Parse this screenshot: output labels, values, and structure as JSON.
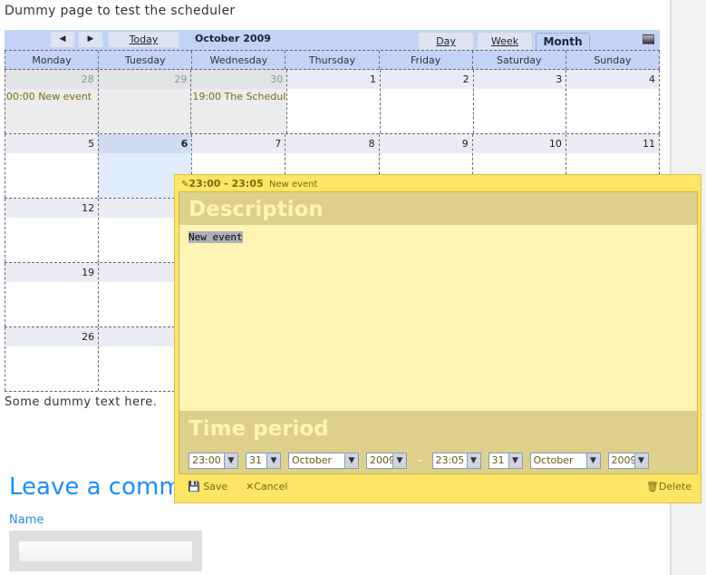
{
  "page": {
    "title": "Dummy page to test the scheduler",
    "dummy_text": "Some dummy text here.",
    "comment_heading": "Leave a comment",
    "name_label": "Name"
  },
  "calendar": {
    "prev": "◀",
    "next": "▶",
    "today": "Today",
    "month_title": "October 2009",
    "tabs": [
      "Day",
      "Week",
      "Month"
    ],
    "active_tab": "Month",
    "weekdays": [
      "Monday",
      "Tuesday",
      "Wednesday",
      "Thursday",
      "Friday",
      "Saturday",
      "Sunday"
    ],
    "weeks": [
      {
        "days": [
          "28",
          "29",
          "30",
          "1",
          "2",
          "3",
          "4"
        ]
      },
      {
        "days": [
          "5",
          "6",
          "7",
          "8",
          "9",
          "10",
          "11"
        ]
      },
      {
        "days": [
          "12",
          "",
          "",
          "",
          "",
          "",
          ""
        ]
      },
      {
        "days": [
          "19",
          "",
          "",
          "",
          "",
          "",
          ""
        ]
      },
      {
        "days": [
          "26",
          "",
          "",
          "",
          "",
          "",
          ""
        ]
      }
    ],
    "events": {
      "monday": "00:00 New event",
      "wednesday": "19:00 The Schedul"
    }
  },
  "popup": {
    "time": "23:00 - 23:05",
    "title": "New event",
    "description_label": "Description",
    "description_value": "New event",
    "time_period_label": "Time period",
    "start": {
      "time": "23:00",
      "day": "31",
      "month": "October",
      "year": "2009"
    },
    "end": {
      "time": "23:05",
      "day": "31",
      "month": "October",
      "year": "2009"
    },
    "separator": "–",
    "save": "Save",
    "cancel": "Cancel",
    "delete": "Delete"
  }
}
